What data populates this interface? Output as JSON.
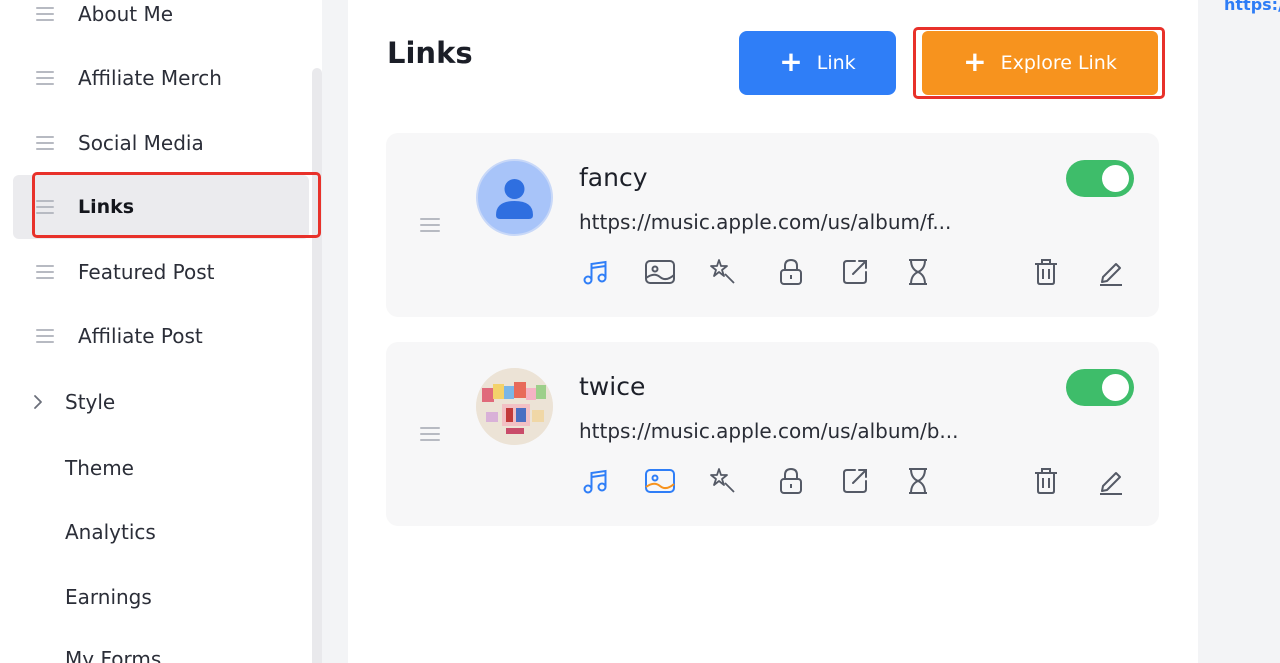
{
  "sidebar": {
    "items": [
      {
        "label": "About Me"
      },
      {
        "label": "Affiliate Merch"
      },
      {
        "label": "Social Media"
      },
      {
        "label": "Links"
      },
      {
        "label": "Featured Post"
      },
      {
        "label": "Affiliate Post"
      },
      {
        "label": "Style"
      },
      {
        "label": "Theme"
      },
      {
        "label": "Analytics"
      },
      {
        "label": "Earnings"
      },
      {
        "label": "My Forms"
      }
    ]
  },
  "main": {
    "title": "Links",
    "add_link_label": "Link",
    "explore_link_label": "Explore Link"
  },
  "links": [
    {
      "title": "fancy",
      "url": "https://music.apple.com/us/album/f...",
      "enabled": true
    },
    {
      "title": "twice",
      "url": "https://music.apple.com/us/album/b...",
      "enabled": true
    }
  ],
  "right_panel": {
    "url": "https://"
  },
  "colors": {
    "primary_blue": "#2f7ef7",
    "accent_orange": "#f7931e",
    "toggle_green": "#3ebd6a",
    "highlight_red": "#e8312a"
  }
}
